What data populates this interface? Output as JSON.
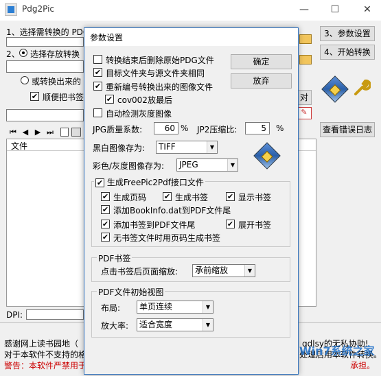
{
  "window": {
    "title": "Pdg2Pic",
    "min": "—",
    "max": "☐",
    "close": "✕"
  },
  "main": {
    "step1": "1、选择需转换的 PDG 文件所在文件夹:",
    "step2_label": "2、",
    "step2_radio": "选择存放转换",
    "radio2": "或转换出来的",
    "check_bookmark": "顺便把书签",
    "btn_params": "3、参数设置",
    "btn_start": "4、开始转换",
    "btn_errlog": "查看错误日志",
    "btn_dui": "对",
    "dpi_label": "DPI:",
    "list_header": "文件",
    "nav": [
      "⏮",
      "◀",
      "▶",
      "⏭"
    ]
  },
  "footer": {
    "line1": "感谢网上读书园地（",
    "line1_end": "qdlsy的无私协助!",
    "line2": "对于本软件不支持的格式，请先用车明的PIZZA（Pdg Into ZeroZero",
    "line2_end": "处理后用本软件转换。",
    "line3": "警告：本软件严禁用于非法目的。使用本软件造成的一切后果（包",
    "line3_end": "承担。",
    "watermark": "Win7系统之家"
  },
  "dialog": {
    "title": "参数设置",
    "ok": "确定",
    "cancel": "放弃",
    "opt1": "转换结束后删除原始PDG文件",
    "opt2": "目标文件夹与源文件夹相同",
    "opt3": "重新编号转换出来的图像文件",
    "opt3a": "cov002放最后",
    "opt4": "自动检测灰度图像",
    "jpg_q_label": "JPG质量系数:",
    "jpg_q": "60",
    "pct": "%",
    "jp2_label": "JP2压缩比:",
    "jp2": "5",
    "bw_label": "黑白图像存为:",
    "bw_value": "TIFF",
    "color_label": "彩色/灰度图像存为:",
    "color_value": "JPEG",
    "fp_group": "生成FreePic2Pdf接口文件",
    "fp_pages": "生成页码",
    "fp_bookmarks": "生成书签",
    "fp_show_bm": "显示书签",
    "fp_bookinfo": "添加BookInfo.dat到PDF文件尾",
    "fp_add_bm": "添加书签到PDF文件尾",
    "fp_expand": "展开书签",
    "fp_nobm": "无书签文件时用页码生成书签",
    "pdfbm_group": "PDF书签",
    "zoom_label": "点击书签后页面缩放:",
    "zoom_value": "承前缩放",
    "view_group": "PDF文件初始视图",
    "layout_label": "布局:",
    "layout_value": "单页连续",
    "scale_label": "放大率:",
    "scale_value": "适合宽度"
  },
  "colors": {
    "accent": "#2c6fbd",
    "warning": "#cc0000"
  }
}
